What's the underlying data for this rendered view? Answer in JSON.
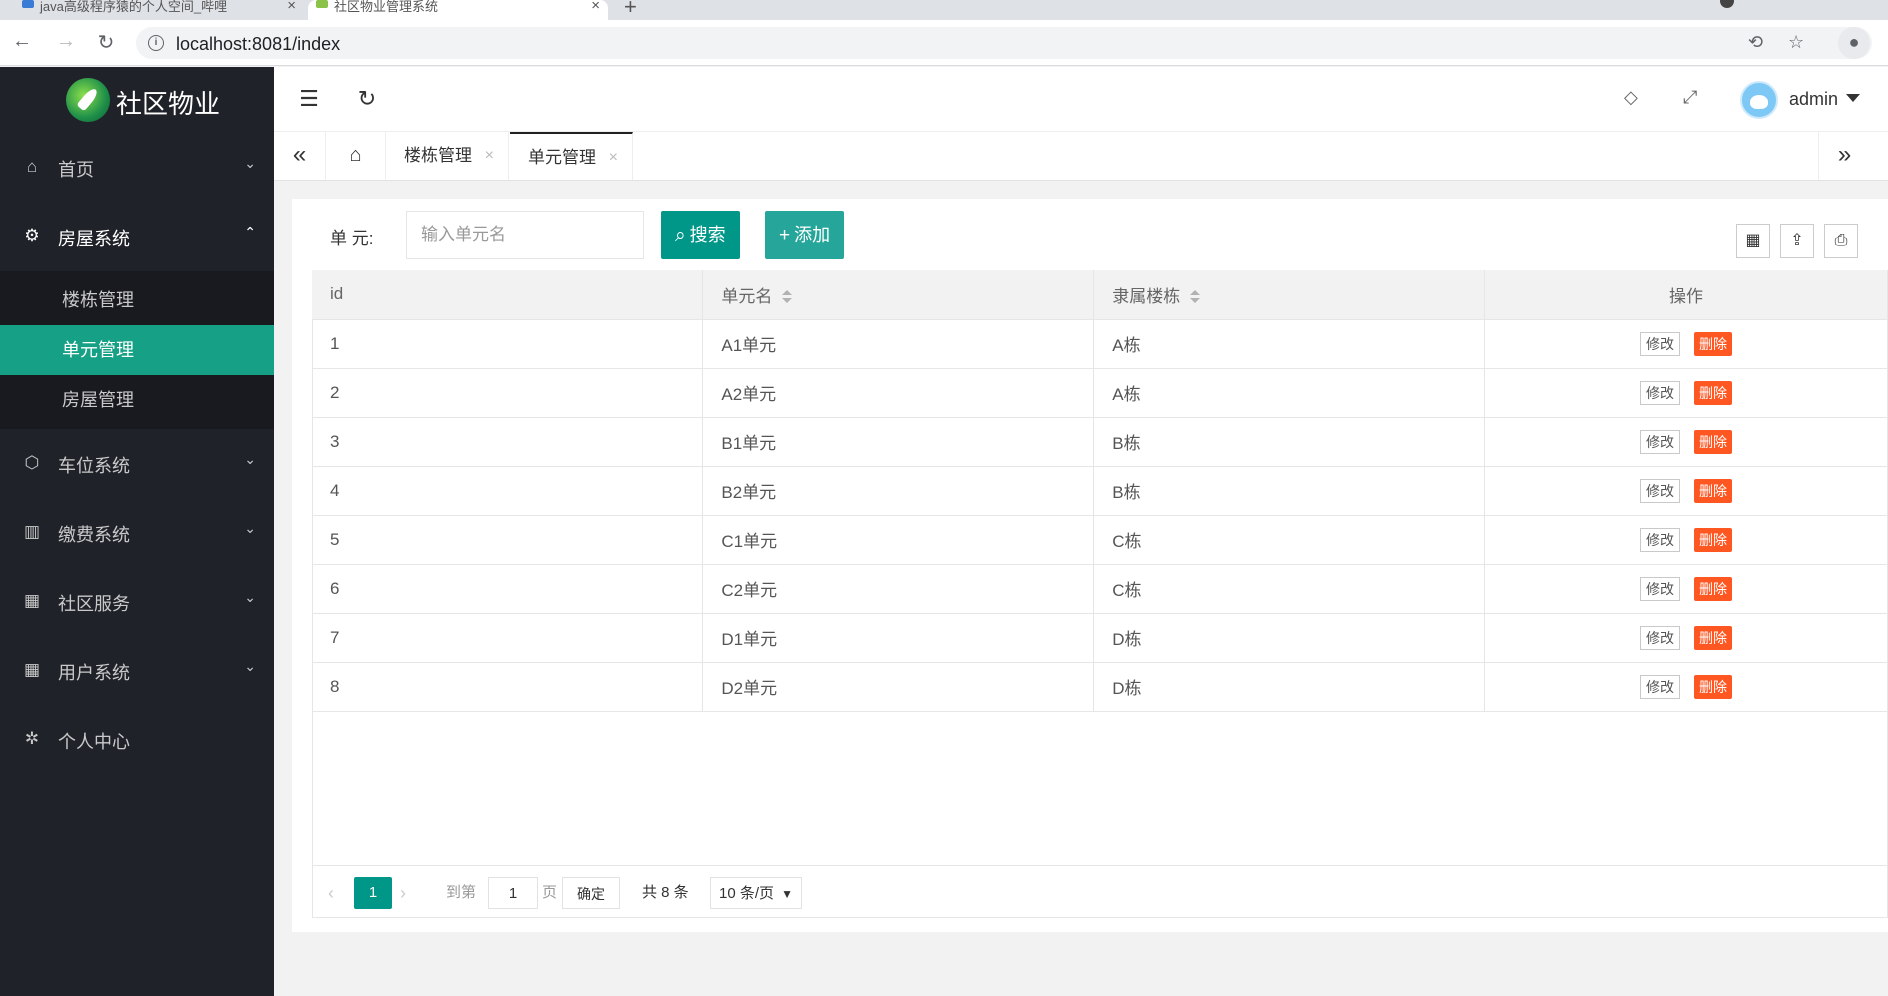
{
  "browser": {
    "tabs": [
      {
        "title": "java高级程序猿的个人空间_哔哩"
      },
      {
        "title": "社区物业管理系统"
      }
    ],
    "url": "localhost:8081/index"
  },
  "sidebar": {
    "logo_text": "社区物业",
    "menu": [
      {
        "label": "首页",
        "icon": "home-icon"
      },
      {
        "label": "房屋系统",
        "icon": "gear-icon",
        "open": true,
        "children": [
          {
            "label": "楼栋管理"
          },
          {
            "label": "单元管理",
            "active": true
          },
          {
            "label": "房屋管理"
          }
        ]
      },
      {
        "label": "车位系统",
        "icon": "cube-icon"
      },
      {
        "label": "缴费系统",
        "icon": "building-icon"
      },
      {
        "label": "社区服务",
        "icon": "apps-icon"
      },
      {
        "label": "用户系统",
        "icon": "apps-icon"
      },
      {
        "label": "个人中心",
        "icon": "gear-icon"
      }
    ]
  },
  "header": {
    "username": "admin"
  },
  "page_tabs": [
    {
      "label": "楼栋管理"
    },
    {
      "label": "单元管理",
      "active": true
    }
  ],
  "filter": {
    "label": "单 元:",
    "placeholder": "输入单元名",
    "search_label": "搜索",
    "add_label": "添加"
  },
  "table": {
    "columns": [
      "id",
      "单元名",
      "隶属楼栋",
      "操作"
    ],
    "rows": [
      {
        "id": "1",
        "name": "A1单元",
        "building": "A栋"
      },
      {
        "id": "2",
        "name": "A2单元",
        "building": "A栋"
      },
      {
        "id": "3",
        "name": "B1单元",
        "building": "B栋"
      },
      {
        "id": "4",
        "name": "B2单元",
        "building": "B栋"
      },
      {
        "id": "5",
        "name": "C1单元",
        "building": "C栋"
      },
      {
        "id": "6",
        "name": "C2单元",
        "building": "C栋"
      },
      {
        "id": "7",
        "name": "D1单元",
        "building": "D栋"
      },
      {
        "id": "8",
        "name": "D2单元",
        "building": "D栋"
      }
    ],
    "edit_label": "修改",
    "delete_label": "删除"
  },
  "pager": {
    "current": "1",
    "goto_label": "到第",
    "page_input": "1",
    "page_unit": "页",
    "confirm_label": "确定",
    "total_text": "共 8 条",
    "page_size": "10 条/页"
  },
  "colors": {
    "sidebar_bg": "#20222a",
    "accent": "#009688",
    "danger": "#ff5722"
  }
}
